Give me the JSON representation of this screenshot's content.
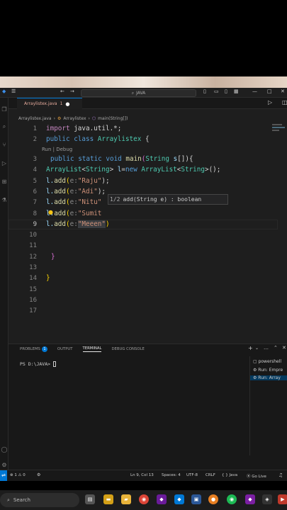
{
  "titlebar": {
    "search_text": "JAVA"
  },
  "tab": {
    "filename": "Arraylistex.java",
    "badge": "1"
  },
  "breadcrumb": {
    "file": "Arraylistex.java",
    "class": "Arraylistex",
    "method": "main(String[])"
  },
  "codelens": "Run | Debug",
  "lines": [
    "1",
    "2",
    "3",
    "4",
    "5",
    "6",
    "7",
    "8",
    "9",
    "10",
    "11",
    "12",
    "13",
    "14",
    "15",
    "16",
    "17"
  ],
  "code": {
    "l1_kw": "import",
    "l1_rest": " java.util.*;",
    "l2_kw": "public",
    "l2_kw2": " class ",
    "l2_cls": "Arraylistex",
    "l2_rest": " {",
    "l4_kw": "public",
    "l4_kw2": " static",
    "l4_kw3": " void",
    "l4_fn": " main",
    "l4_p1": "(",
    "l4_ty": "String",
    "l4_var": " s",
    "l4_p2": "[]){",
    "l5_ty": "ArrayList",
    "l5_a": "<",
    "l5_ty2": "String",
    "l5_b": "> ",
    "l5_var": "l",
    "l5_c": "=",
    "l5_kw": "new",
    "l5_ty3": " ArrayList",
    "l5_d": "<",
    "l5_ty4": "String",
    "l5_e": ">();",
    "add_prefix": "l.",
    "add_fn": "add",
    "add_open": "(",
    "hint": "e:",
    "s6": "\"Raju\"",
    "s7": "\"Adi\"",
    "s8": "\"Nitu\"",
    "s9": "\"Sumit",
    "s10": "\"Meeen\"",
    "close": ");",
    "close9": ")",
    "brace1": "}",
    "brace2": "}"
  },
  "signature_popup": {
    "counter": "1/2",
    "signature": "add(String e) : boolean"
  },
  "panel": {
    "tabs": [
      "PROBLEMS",
      "OUTPUT",
      "TERMINAL",
      "DEBUG CONSOLE"
    ],
    "problems_badge": "1",
    "prompt": "PS D:\\JAVA> ",
    "terminals": [
      "powershell",
      "Run: Empre",
      "Run: Array"
    ]
  },
  "statusbar": {
    "problems": "⊗ 1 ⚠ 0",
    "position": "Ln 9, Col 13",
    "spaces": "Spaces: 4",
    "encoding": "UTF-8",
    "eol": "CRLF",
    "language": "{ } Java",
    "golive": "Go Live"
  },
  "taskbar": {
    "search": "Search"
  },
  "colors": {
    "accent": "#0078d4",
    "editor_bg": "#1e1e1e",
    "string": "#ce9178",
    "keyword": "#569cd6"
  }
}
